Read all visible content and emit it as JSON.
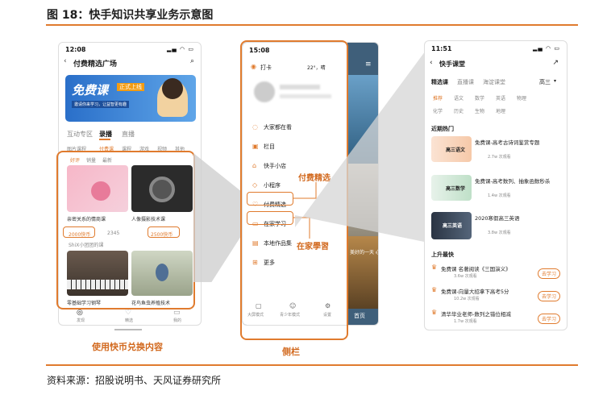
{
  "figure": {
    "title": "图 18：快手知识共享业务示意图",
    "source": "资料来源：招股说明书、天风证券研究所"
  },
  "p1": {
    "time": "12:08",
    "title": "付费精选广场",
    "banner": "免费课",
    "banner_sub": "正式上线",
    "banner_note": "邀请你来学习，让益智更有趣",
    "tabs": [
      "互动专区",
      "录播",
      "直播"
    ],
    "subtabs": [
      "图片课程",
      "付费课",
      "课程",
      "游戏",
      "视频",
      "其他"
    ],
    "chips": [
      "好评",
      "销量",
      "最新"
    ],
    "course1": "亲密关系的情商课",
    "course2": "人像摄影技术课",
    "price1": "2000快币",
    "price2": "2500快币",
    "teacher": "ShiX小团团的课",
    "views": "2345",
    "course3": "零基础学习钢琴",
    "course4": "花鸟鱼虫养殖技术",
    "nav": [
      "发现",
      "精选",
      "我的"
    ],
    "caption": "使用快币兑换内容"
  },
  "p2": {
    "time": "15:08",
    "checkin": "打卡",
    "weather": "22°，晴",
    "menu": [
      "大家都在看",
      "栏目",
      "快手小店",
      "小程序",
      "付费精选",
      "在家学习",
      "本地作品集",
      "更多"
    ],
    "bottom": [
      "大屏模式",
      "青少年模式",
      "设置"
    ],
    "label_fufei": "付费精选",
    "label_zaijia": "在家學習",
    "caption": "侧栏",
    "side_text": "美好的一天 心情开始",
    "home": "首页"
  },
  "p3": {
    "time": "11:51",
    "title": "快手课堂",
    "grade": "高三",
    "tabs": [
      "精选课",
      "直播课",
      "海淀课堂"
    ],
    "subjects": [
      "推荐",
      "语文",
      "数学",
      "英语",
      "物理",
      "化学",
      "历史",
      "生物",
      "地理"
    ],
    "hot_title": "近期热门",
    "hot": [
      {
        "title": "免费课-高考古诗词鉴赏专题",
        "thumb": "高三语文",
        "meta": "2.7w 次观看"
      },
      {
        "title": "免费课-高考数列、抽象函数秒杀",
        "thumb": "高三数学",
        "meta": "1.4w 次观看"
      },
      {
        "title": "2020寒假高三英语",
        "thumb": "高三英语",
        "meta": "3.8w 次观看"
      }
    ],
    "up_title": "上升最快",
    "up": [
      {
        "title": "免费课 名著阅读《三国演义》",
        "meta": "3.6w 次观看"
      },
      {
        "title": "免费课-向量大招拿下高考5分",
        "meta": "10.2w 次观看"
      },
      {
        "title": "清华毕业老师-数列之错位相减",
        "meta": "1.7w 次观看"
      }
    ],
    "btn": "去学习"
  }
}
